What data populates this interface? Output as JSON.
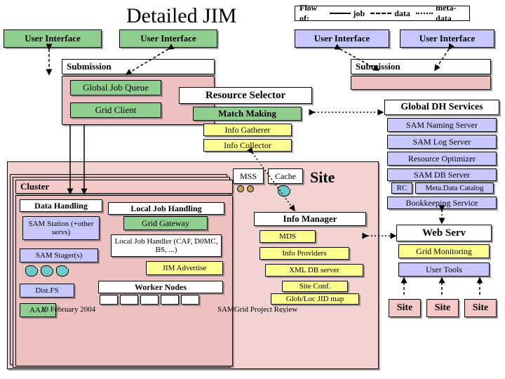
{
  "title": "Detailed JIM",
  "legend": {
    "label": "Flow of:",
    "job": "job",
    "data": "data",
    "meta": "meta-data"
  },
  "ui": "User Interface",
  "submission": "Submission",
  "global_job_queue": "Global Job Queue",
  "grid_client": "Grid Client",
  "resource_selector": "Resource Selector",
  "match_making": "Match Making",
  "info_gatherer": "Info Gatherer",
  "info_collector": "Info Collector",
  "global_dh": "Global DH Services",
  "sam_naming": "SAM Naming Server",
  "sam_log": "SAM Log Server",
  "resource_opt": "Resource Optimizer",
  "sam_db": "SAM DB Server",
  "rc": "RC",
  "meta_cat": "Meta.Data Catalog",
  "bookkeeping": "Bookkeeping Service",
  "web_serv": "Web Serv",
  "grid_monitoring": "Grid Monitoring",
  "user_tools": "User Tools",
  "cluster": "Cluster",
  "data_handling": "Data Handling",
  "local_job_handling": "Local Job Handling",
  "sam_station": "SAM Station (+other servs)",
  "grid_gateway": "Grid Gateway",
  "local_job_handler": "Local Job Handler (CAF, D0MC, BS, ...)",
  "sam_stager": "SAM Stager(s)",
  "jim_advertise": "JIM Advertise",
  "dist_fs": "Dist.FS",
  "worker_nodes": "Worker Nodes",
  "aaa": "AAA",
  "mss": "MSS",
  "cache": "Cache",
  "site": "Site",
  "info_manager": "Info Manager",
  "mds": "MDS",
  "info_providers": "Info Providers",
  "xml_db": "XML DB server",
  "site_conf": "Site Conf.",
  "glob_loc": "Glob/Loc JID map",
  "dots": "...",
  "footer_left": "19 February 2004",
  "footer_right": "SAMGrid Project Review",
  "chart_data": {
    "type": "diagram",
    "title": "Detailed JIM",
    "legend": [
      {
        "name": "job",
        "style": "solid"
      },
      {
        "name": "data",
        "style": "dashed"
      },
      {
        "name": "meta-data",
        "style": "dotted"
      }
    ],
    "top_nodes": [
      "User Interface",
      "User Interface",
      "User Interface",
      "User Interface"
    ],
    "submission_left": {
      "label": "Submission",
      "children": [
        "Global Job Queue",
        "Grid Client"
      ]
    },
    "submission_right": {
      "label": "Submission"
    },
    "resource_selector": {
      "label": "Resource Selector",
      "children": [
        "Match Making",
        "Info Gatherer",
        "Info Collector"
      ]
    },
    "global_dh_services": {
      "label": "Global DH Services",
      "children": [
        "SAM Naming Server",
        "SAM Log Server",
        "Resource Optimizer",
        "SAM DB Server",
        "RC",
        "Meta.Data Catalog",
        "Bookkeeping Service"
      ]
    },
    "cluster": {
      "label": "Cluster",
      "sections": {
        "Data Handling": [
          "SAM Station (+other servs)",
          "SAM Stager(s)",
          "Dist.FS",
          "AAA"
        ],
        "Local Job Handling": [
          "Grid Gateway",
          "Local Job Handler (CAF, D0MC, BS, ...)",
          "JIM Advertise",
          "Worker Nodes"
        ]
      }
    },
    "site_block": {
      "label": "Site",
      "children": [
        "MSS",
        "Cache",
        "Info Manager",
        "MDS",
        "Info Providers",
        "XML DB server",
        "Site Conf.",
        "Glob/Loc JID map",
        "..."
      ]
    },
    "right_column": [
      "Web Serv",
      "Grid Monitoring",
      "User Tools"
    ],
    "bottom_sites": [
      "Site",
      "Site",
      "Site"
    ]
  }
}
